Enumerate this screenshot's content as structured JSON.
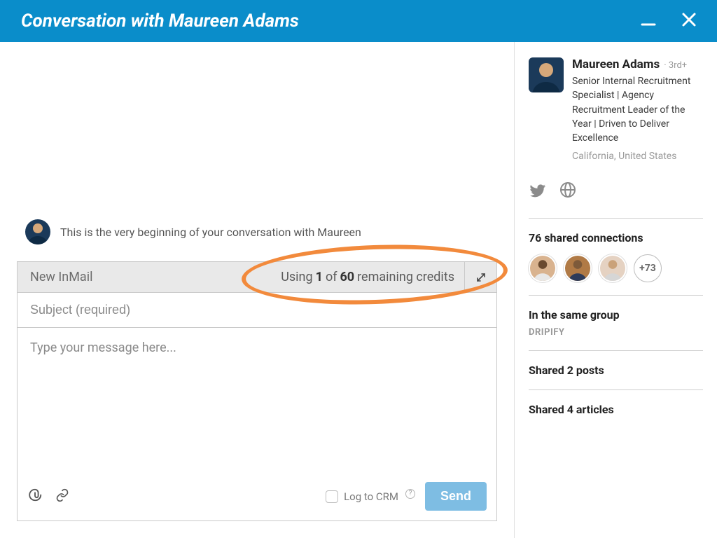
{
  "window": {
    "title": "Conversation with Maureen Adams"
  },
  "conversation": {
    "start_text": "This is the very beginning of your conversation with Maureen"
  },
  "compose": {
    "header_label": "New InMail",
    "credits_prefix": "Using",
    "credits_used": "1",
    "credits_mid": "of",
    "credits_total": "60",
    "credits_suffix": "remaining credits",
    "subject_placeholder": "Subject (required)",
    "body_placeholder": "Type your message here...",
    "log_crm_label": "Log to CRM",
    "send_label": "Send"
  },
  "profile": {
    "name": "Maureen Adams",
    "degree": "· 3rd+",
    "headline": "Senior Internal Recruitment Specialist | Agency Recruitment Leader of the Year | Driven to Deliver Excellence",
    "location": "California, United States"
  },
  "sidebar": {
    "shared_connections_title": "76 shared connections",
    "more_connections": "+73",
    "same_group_title": "In the same group",
    "same_group_name": "DRIPIFY",
    "shared_posts_title": "Shared 2 posts",
    "shared_articles_title": "Shared 4 articles"
  }
}
